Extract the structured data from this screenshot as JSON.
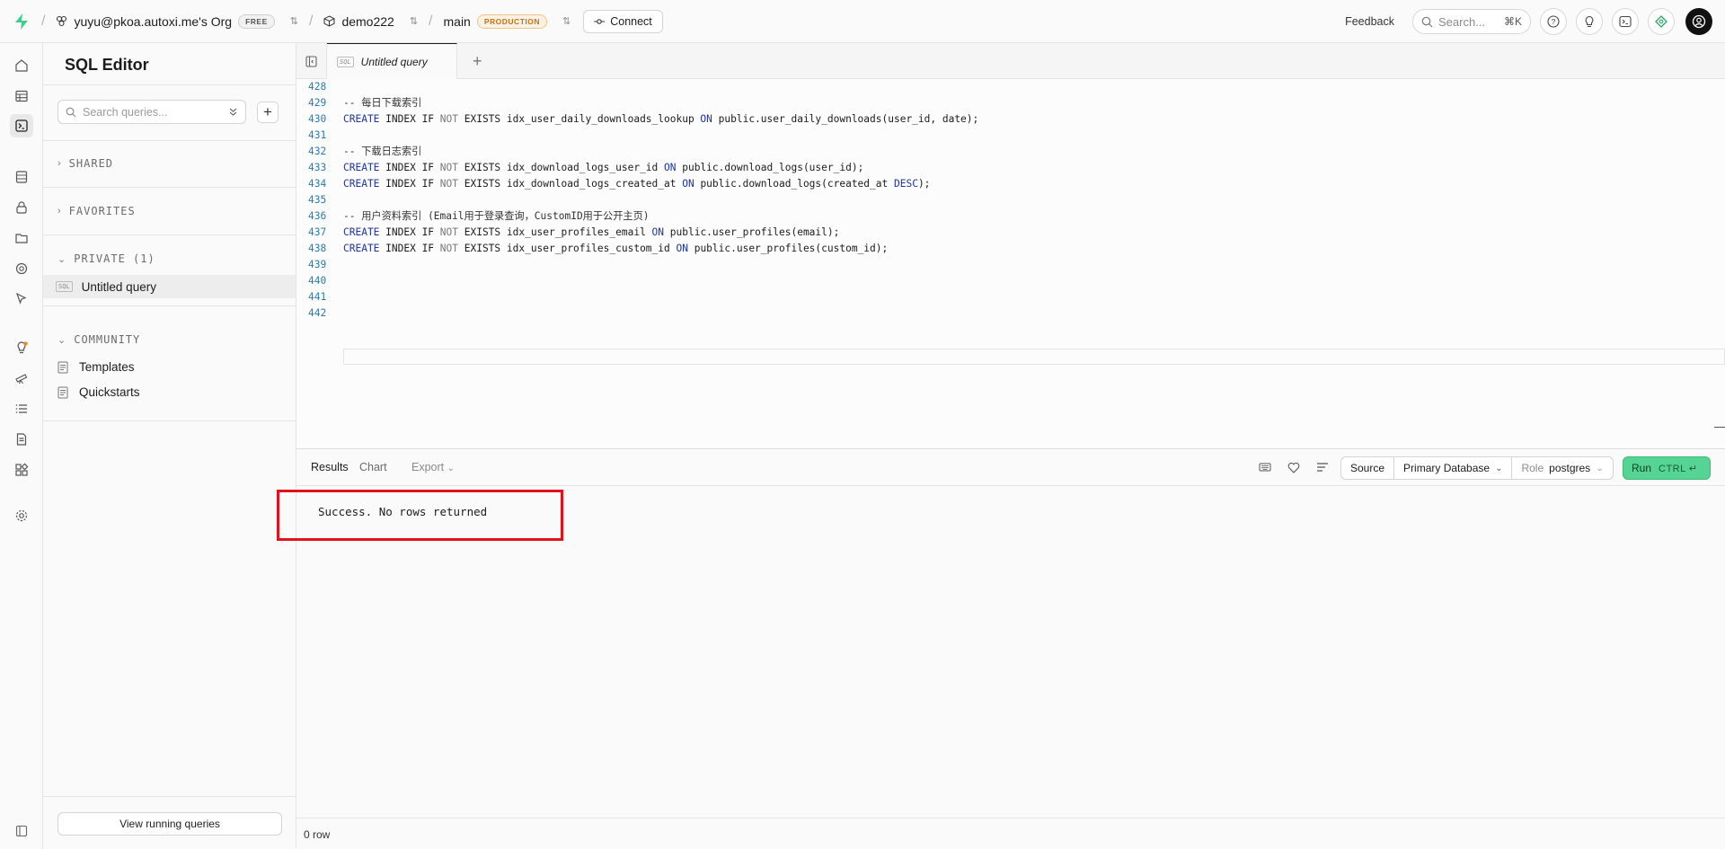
{
  "topbar": {
    "org_name": "yuyu@pkoa.autoxi.me's Org",
    "org_badge": "FREE",
    "project_name": "demo222",
    "branch_name": "main",
    "branch_badge": "PRODUCTION",
    "connect_label": "Connect",
    "feedback_label": "Feedback",
    "search_placeholder": "Search...",
    "search_shortcut": "⌘K"
  },
  "sidebar": {
    "title": "SQL Editor",
    "search_placeholder": "Search queries...",
    "sections": {
      "shared": "SHARED",
      "favorites": "FAVORITES",
      "private": "PRIVATE (1)",
      "community": "COMMUNITY"
    },
    "private_items": [
      {
        "label": "Untitled query",
        "chip": "SQL"
      }
    ],
    "community_items": [
      {
        "label": "Templates"
      },
      {
        "label": "Quickstarts"
      }
    ],
    "running_queries_label": "View running queries"
  },
  "editor": {
    "tab_label": "Untitled query",
    "tab_chip": "SQL",
    "lines": [
      {
        "n": "428",
        "text": ""
      },
      {
        "n": "429",
        "text": "-- 每日下载索引"
      },
      {
        "n": "430",
        "text": "CREATE INDEX IF NOT EXISTS idx_user_daily_downloads_lookup ON public.user_daily_downloads(user_id, date);"
      },
      {
        "n": "431",
        "text": ""
      },
      {
        "n": "432",
        "text": "-- 下载日志索引"
      },
      {
        "n": "433",
        "text": "CREATE INDEX IF NOT EXISTS idx_download_logs_user_id ON public.download_logs(user_id);"
      },
      {
        "n": "434",
        "text": "CREATE INDEX IF NOT EXISTS idx_download_logs_created_at ON public.download_logs(created_at DESC);"
      },
      {
        "n": "435",
        "text": ""
      },
      {
        "n": "436",
        "text": "-- 用户资料索引 (Email用于登录查询，CustomID用于公开主页)"
      },
      {
        "n": "437",
        "text": "CREATE INDEX IF NOT EXISTS idx_user_profiles_email ON public.user_profiles(email);"
      },
      {
        "n": "438",
        "text": "CREATE INDEX IF NOT EXISTS idx_user_profiles_custom_id ON public.user_profiles(custom_id);"
      },
      {
        "n": "439",
        "text": ""
      },
      {
        "n": "440",
        "text": ""
      },
      {
        "n": "441",
        "text": ""
      },
      {
        "n": "442",
        "text": ""
      }
    ]
  },
  "results": {
    "tabs": {
      "results": "Results",
      "chart": "Chart",
      "export": "Export"
    },
    "source_label": "Source",
    "database_label": "Primary Database",
    "role_prefix": "Role",
    "role_value": "postgres",
    "run_label": "Run",
    "run_shortcut": "CTRL ↵",
    "message": "Success. No rows returned",
    "row_count": "0 row"
  },
  "colors": {
    "accent_green": "#56d494",
    "highlight_red": "#e0121b",
    "keyword_blue": "#1d34a8"
  }
}
